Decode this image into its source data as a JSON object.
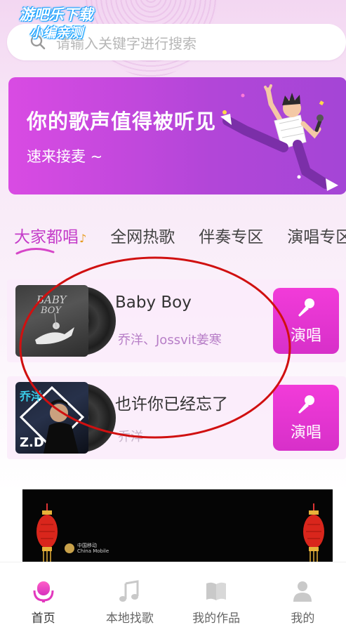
{
  "watermark": {
    "line1": "游吧乐下载",
    "line2": "小编亲测"
  },
  "search": {
    "placeholder": "请输入关键字进行搜索"
  },
  "banner": {
    "title": "你的歌声值得被听见",
    "subtitle": "速来接麦 ~"
  },
  "tabs": [
    {
      "label": "大家都唱",
      "active": true
    },
    {
      "label": "全网热歌",
      "active": false
    },
    {
      "label": "伴奏专区",
      "active": false
    },
    {
      "label": "演唱专区",
      "active": false
    }
  ],
  "songs": [
    {
      "title": "Baby Boy",
      "artist": "乔洋、Jossvit姜寒",
      "sing_label": "演唱",
      "cover_text": "BABY BOY"
    },
    {
      "title": "也许你已经忘了",
      "artist": "乔洋",
      "sing_label": "演唱",
      "cover_text": "乔洋 Z.D"
    }
  ],
  "ad": {
    "logo_text_cn": "中国移动",
    "logo_text_en": "China Mobile"
  },
  "nav": [
    {
      "label": "首页",
      "icon": "mic-icon",
      "active": true
    },
    {
      "label": "本地找歌",
      "icon": "music-note-icon",
      "active": false
    },
    {
      "label": "我的作品",
      "icon": "book-icon",
      "active": false
    },
    {
      "label": "我的",
      "icon": "user-icon",
      "active": false
    }
  ],
  "colors": {
    "accent": "#d730c9",
    "banner": "#c546dd",
    "annotation": "#d01010"
  }
}
